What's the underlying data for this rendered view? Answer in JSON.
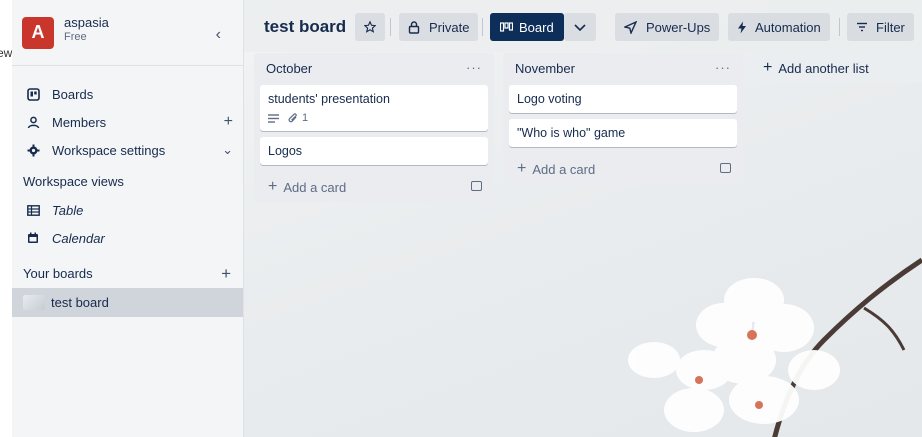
{
  "left_strip_text": "ew",
  "workspace": {
    "avatar_letter": "A",
    "name": "aspasia",
    "plan": "Free",
    "collapse_icon": "chevron-left-icon"
  },
  "nav": {
    "boards": "Boards",
    "members": "Members",
    "settings": "Workspace settings",
    "views_title": "Workspace views",
    "table": "Table",
    "calendar": "Calendar",
    "your_boards_title": "Your boards",
    "board_item": "test board"
  },
  "topbar": {
    "title": "test board",
    "private": "Private",
    "board": "Board",
    "powerups": "Power-Ups",
    "automation": "Automation",
    "filter": "Filter"
  },
  "lists": [
    {
      "title": "October",
      "cards": [
        {
          "title": "students' presentation",
          "attachments": "1"
        },
        {
          "title": "Logos"
        }
      ],
      "add_card": "Add a card"
    },
    {
      "title": "November",
      "cards": [
        {
          "title": "Logo voting"
        },
        {
          "title": "\"Who is who\" game"
        }
      ],
      "add_card": "Add a card"
    }
  ],
  "add_list": "Add another list",
  "colors": {
    "avatar": "#c9372c",
    "board_button": "#0c2e59",
    "sidebar": "#f4f5f7"
  }
}
